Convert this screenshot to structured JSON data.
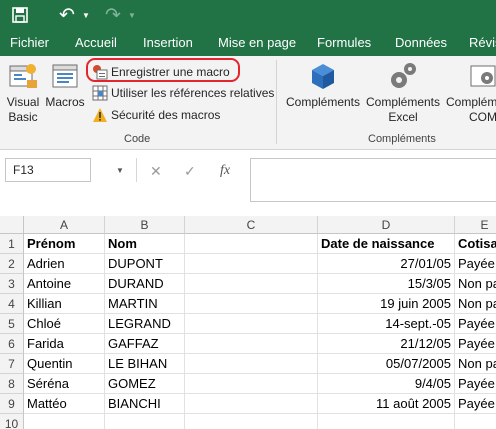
{
  "tabs": [
    "Fichier",
    "Accueil",
    "Insertion",
    "Mise en page",
    "Formules",
    "Données",
    "Révis"
  ],
  "ribbon": {
    "visual_basic": [
      "Visual",
      "Basic"
    ],
    "macros": "Macros",
    "record_macro": "Enregistrer une macro",
    "relative_refs": "Utiliser les références relatives",
    "macro_security": "Sécurité des macros",
    "code_group": "Code",
    "complements": "Compléments",
    "complements_excel": [
      "Compléments",
      "Excel"
    ],
    "complements_com": [
      "Compléments",
      "COM"
    ],
    "complements_group": "Compléments"
  },
  "formula_bar": {
    "name_box": "F13",
    "cancel": "✕",
    "enter": "✓",
    "fx": "fx",
    "value": ""
  },
  "columns": [
    "A",
    "B",
    "C",
    "D",
    "E"
  ],
  "rows": [
    [
      "1",
      "Prénom",
      "Nom",
      "",
      "Date de naissance",
      "Cotisat"
    ],
    [
      "2",
      "Adrien",
      "DUPONT",
      "",
      "27/01/05",
      "Payée"
    ],
    [
      "3",
      "Antoine",
      "DURAND",
      "",
      "15/3/05",
      "Non pa"
    ],
    [
      "4",
      "Killian",
      "MARTIN",
      "",
      "19 juin 2005",
      "Non pa"
    ],
    [
      "5",
      "Chloé",
      "LEGRAND",
      "",
      "14-sept.-05",
      "Payée"
    ],
    [
      "6",
      "Farida",
      "GAFFAZ",
      "",
      "21/12/05",
      "Payée"
    ],
    [
      "7",
      "Quentin",
      "LE BIHAN",
      "",
      "05/07/2005",
      "Non pa"
    ],
    [
      "8",
      "Séréna",
      "GOMEZ",
      "",
      "9/4/05",
      "Payée"
    ],
    [
      "9",
      "Mattéo",
      "BIANCHI",
      "",
      "11 août 2005",
      "Payée"
    ],
    [
      "10",
      "",
      "",
      "",
      "",
      ""
    ]
  ],
  "colors": {
    "accent": "#217346",
    "highlight": "#e3262b"
  }
}
